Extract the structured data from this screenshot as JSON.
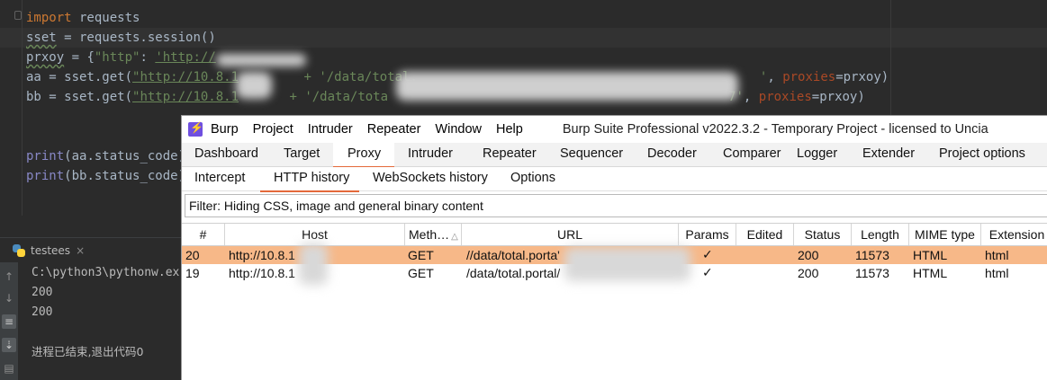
{
  "editor": {
    "lines": {
      "l1": {
        "kw": "import",
        "rest": " requests"
      },
      "l2": {
        "var": "sset",
        "eq": " = requests.",
        "call": "session",
        "tail": "()"
      },
      "l3": {
        "var": "prxoy",
        "eq": " = {",
        "key": "\"http\"",
        "colon": ": ",
        "val": "'http://"
      },
      "l4": {
        "head": "aa = sset.get(",
        "url": "\"http://10.8.1",
        "mid": " + '/data/total.",
        "tail_str": "'",
        "comma": ", ",
        "kwarg": "proxies",
        "end": "=prxoy)"
      },
      "l5": {
        "head": "bb = sset.get(",
        "url": "\"http://10.8.1",
        "mid": " + '/data/tota",
        "tail_str": "7'",
        "comma": ", ",
        "kwarg": "proxies",
        "end": "=prxoy)"
      },
      "l6": {
        "fn": "print",
        "arg": "(aa.status_code)"
      },
      "l7": {
        "fn": "print",
        "arg": "(bb.status_code)"
      }
    }
  },
  "run_panel": {
    "tab_label": "testees",
    "close": "×",
    "console": [
      "C:\\python3\\pythonw.ex",
      "200",
      "200",
      "",
      "进程已结束,退出代码0"
    ]
  },
  "burp": {
    "menu": [
      "Burp",
      "Project",
      "Intruder",
      "Repeater",
      "Window",
      "Help"
    ],
    "title": "Burp Suite Professional v2022.3.2 - Temporary Project - licensed to Uncia",
    "main_tabs": [
      "Dashboard",
      "Target",
      "Proxy",
      "Intruder",
      "Repeater",
      "Sequencer",
      "Decoder",
      "Comparer",
      "Logger",
      "Extender",
      "Project options"
    ],
    "active_main_tab": "Proxy",
    "sub_tabs": [
      "Intercept",
      "HTTP history",
      "WebSockets history",
      "Options"
    ],
    "active_sub_tab": "HTTP history",
    "filter": "Filter: Hiding CSS, image and general binary content",
    "columns": [
      "#",
      "Host",
      "Meth…",
      "URL",
      "Params",
      "Edited",
      "Status",
      "Length",
      "MIME type",
      "Extension"
    ],
    "sort_indicator": "△",
    "rows": [
      {
        "num": "20",
        "host": "http://10.8.1",
        "method": "GET",
        "url": "//data/total.porta'",
        "params": "✓",
        "edited": "",
        "status": "200",
        "length": "11573",
        "mime": "HTML",
        "ext": "html",
        "selected": true
      },
      {
        "num": "19",
        "host": "http://10.8.1",
        "method": "GET",
        "url": "/data/total.portal/",
        "params": "✓",
        "edited": "",
        "status": "200",
        "length": "11573",
        "mime": "HTML",
        "ext": "html",
        "selected": false
      }
    ],
    "accent_color": "#e4693a",
    "selected_row_color": "#f7b888"
  }
}
